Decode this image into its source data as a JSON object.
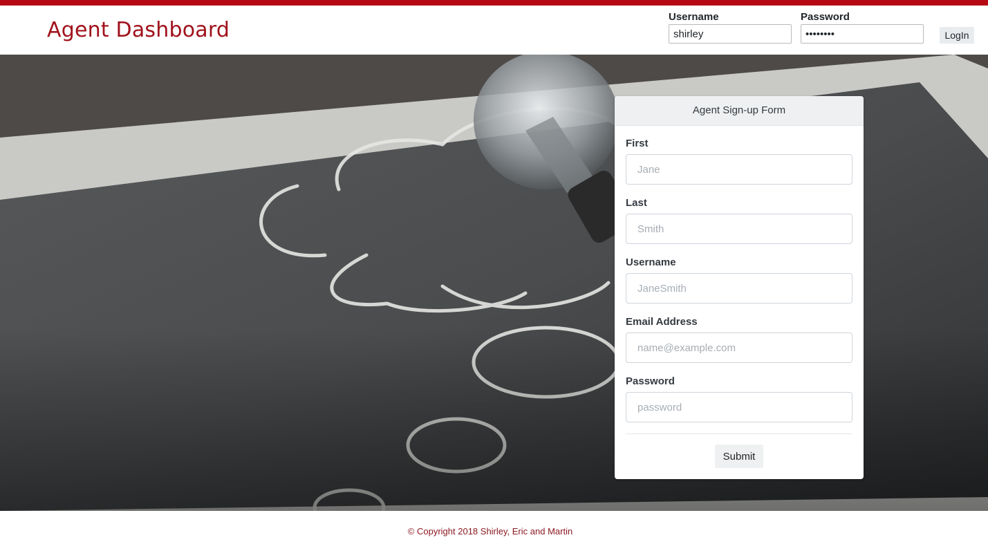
{
  "header": {
    "brand": "Agent Dashboard",
    "login": {
      "username_label": "Username",
      "username_value": "shirley",
      "password_label": "Password",
      "password_value": "password",
      "button_label": "LogIn"
    }
  },
  "signup_form": {
    "title": "Agent Sign-up Form",
    "fields": [
      {
        "label": "First",
        "placeholder": "Jane"
      },
      {
        "label": "Last",
        "placeholder": "Smith"
      },
      {
        "label": "Username",
        "placeholder": "JaneSmith"
      },
      {
        "label": "Email Address",
        "placeholder": "name@example.com"
      },
      {
        "label": "Password",
        "placeholder": "password"
      }
    ],
    "submit_label": "Submit"
  },
  "footer": {
    "copyright": "© Copyright 2018 Shirley, Eric and Martin"
  },
  "colors": {
    "accent": "#b50a14",
    "brand_text": "#a0111b",
    "footer_text": "#8b1a22"
  }
}
